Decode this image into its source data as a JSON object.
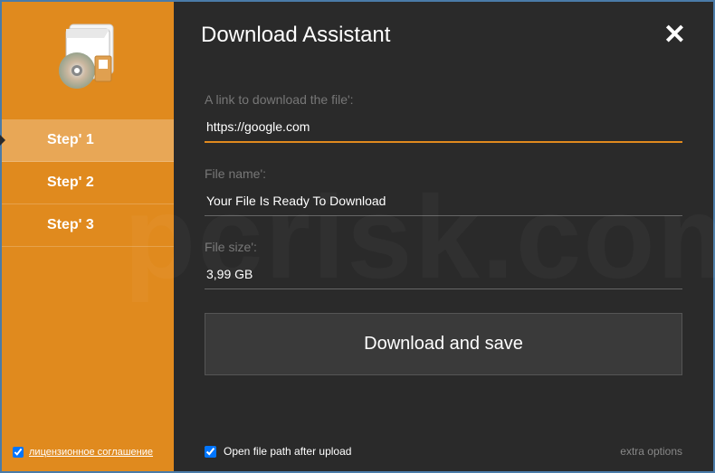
{
  "title": "Download Assistant",
  "sidebar": {
    "steps": [
      {
        "label": "Step' 1"
      },
      {
        "label": "Step' 2"
      },
      {
        "label": "Step' 3"
      }
    ],
    "license": {
      "label": "лицензионное соглашение",
      "checked": true
    }
  },
  "fields": {
    "link": {
      "label": "A link to download the file':",
      "value": "https://google.com"
    },
    "filename": {
      "label": "File name':",
      "value": "Your File Is Ready To Download"
    },
    "filesize": {
      "label": "File size':",
      "value": "3,99 GB"
    }
  },
  "button": {
    "label": "Download and save"
  },
  "footer": {
    "openPath": {
      "label": "Open file path after upload",
      "checked": true
    },
    "extra": {
      "label": "extra options"
    }
  },
  "watermark": "pcrisk.com"
}
